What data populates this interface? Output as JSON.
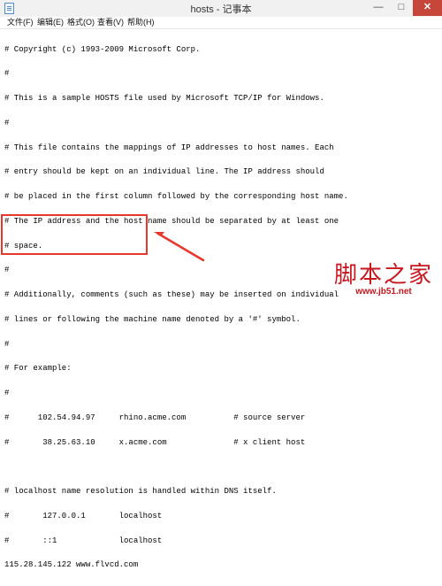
{
  "window": {
    "title": "hosts - 记事本",
    "minimize_symbol": "—",
    "maximize_symbol": "□",
    "close_symbol": "✕"
  },
  "menu": [
    {
      "label": "文件(F)"
    },
    {
      "label": "编辑(E)"
    },
    {
      "label": "格式(O)"
    },
    {
      "label": "查看(V)"
    },
    {
      "label": "帮助(H)"
    }
  ],
  "editor": {
    "lines": [
      "# Copyright (c) 1993-2009 Microsoft Corp.",
      "#",
      "# This is a sample HOSTS file used by Microsoft TCP/IP for Windows.",
      "#",
      "# This file contains the mappings of IP addresses to host names. Each",
      "# entry should be kept on an individual line. The IP address should",
      "# be placed in the first column followed by the corresponding host name.",
      "# The IP address and the host name should be separated by at least one",
      "# space.",
      "#",
      "# Additionally, comments (such as these) may be inserted on individual",
      "# lines or following the machine name denoted by a '#' symbol.",
      "#",
      "# For example:",
      "#",
      "#      102.54.94.97     rhino.acme.com          # source server",
      "#       38.25.63.10     x.acme.com              # x client host",
      "",
      "# localhost name resolution is handled within DNS itself.",
      "#       127.0.0.1       localhost",
      "#       ::1             localhost",
      "115.28.145.122 www.flvcd.com"
    ]
  },
  "annotation": {
    "highlight_color": "#e8372b",
    "arrow_color": "#e8372b"
  },
  "watermark": {
    "brand": "脚本之家",
    "url": "www.jb51.net",
    "color": "#c8171e"
  }
}
